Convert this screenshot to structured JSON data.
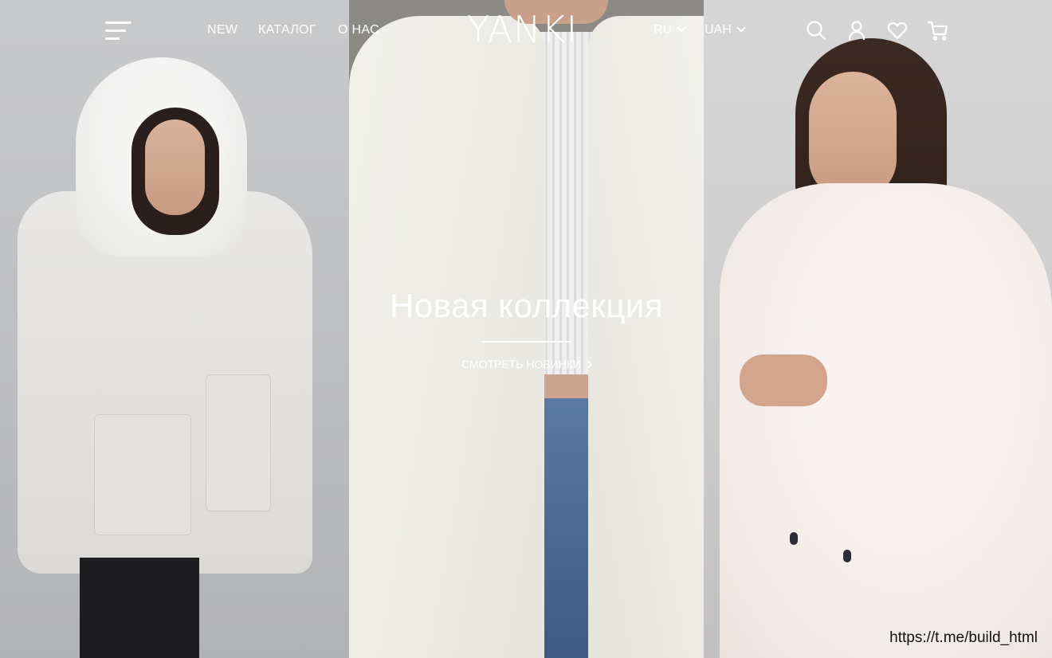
{
  "header": {
    "logo": "YANKI",
    "nav": [
      "NEW",
      "КАТАЛОГ",
      "О НАС"
    ],
    "language": "RU",
    "currency": "UAH",
    "icons": [
      "menu-icon",
      "search-icon",
      "user-icon",
      "heart-icon",
      "cart-icon"
    ]
  },
  "hero": {
    "title": "Новая коллекция",
    "link_label": "СМОТРЕТЬ НОВИНКИ",
    "panels": [
      "left-photo-white-parka",
      "center-photo-white-coat",
      "right-photo-fur-coat"
    ]
  },
  "watermark": "https://t.me/build_html",
  "colors": {
    "text_on_photo": "#ffffff",
    "watermark_text": "#111111"
  }
}
